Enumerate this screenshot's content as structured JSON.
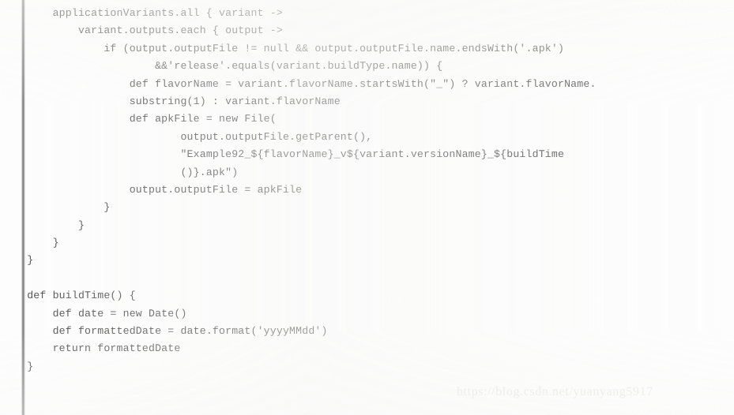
{
  "page": {
    "kind": "code-screenshot",
    "language": "groovy",
    "background_color": "#fdfdfd",
    "text_color": "#4d4d4d",
    "gutter_color": "#6c6c6c"
  },
  "code": {
    "lines": [
      "      applicationVariants.all { variant ->",
      "          variant.outputs.each { output ->",
      "              if (output.outputFile != null && output.outputFile.name.endsWith('.apk')",
      "                      &&'release'.equals(variant.buildType.name)) {",
      "                  def flavorName = variant.flavorName.startsWith(\"_\") ? variant.flavorName.",
      "                  substring(1) : variant.flavorName",
      "                  def apkFile = new File(",
      "                          output.outputFile.getParent(),",
      "                          \"Example92_${flavorName}_v${variant.versionName}_${buildTime",
      "                          ()}.apk\")",
      "                  output.outputFile = apkFile",
      "              }",
      "          }",
      "      }",
      "  }",
      "",
      "  def buildTime() {",
      "      def date = new Date()",
      "      def formattedDate = date.format('yyyyMMdd')",
      "      return formattedDate",
      "  }"
    ]
  },
  "watermark": {
    "text": "https://blog.csdn.net/yuanyang5917"
  }
}
